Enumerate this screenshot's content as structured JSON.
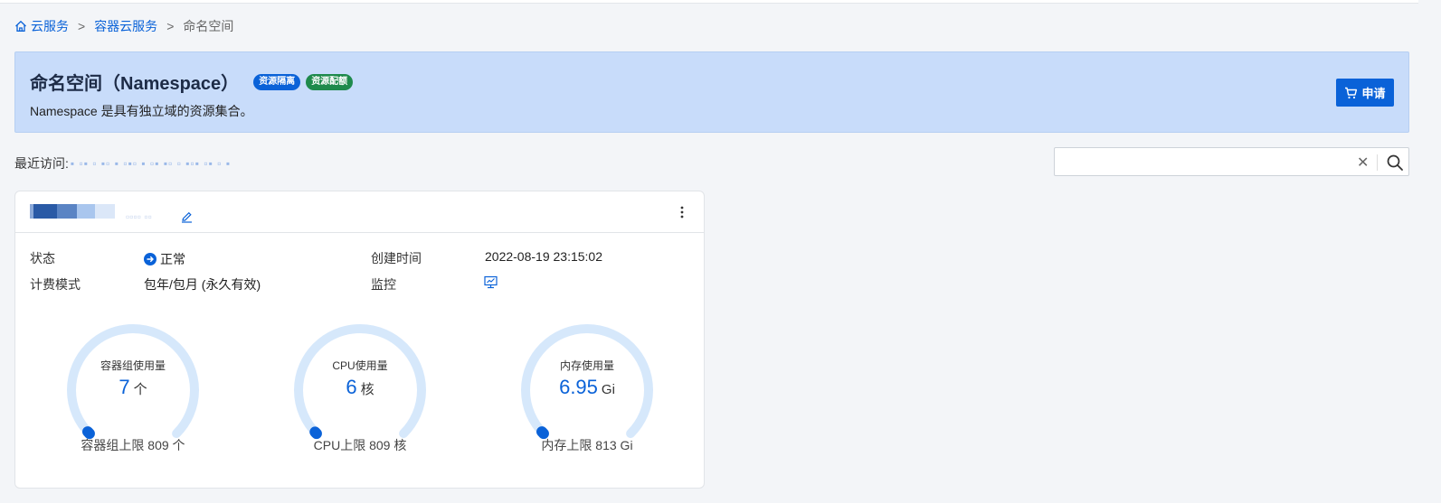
{
  "breadcrumb": {
    "home": "云服务",
    "sep1": ">",
    "level2": "容器云服务",
    "sep2": ">",
    "current": "命名空间"
  },
  "banner": {
    "title": "命名空间（Namespace）",
    "badge_isolation": "资源隔离",
    "badge_quota": "资源配额",
    "description": "Namespace 是具有独立域的资源集合。",
    "apply_label": "申请"
  },
  "recent": {
    "label": "最近访问:"
  },
  "search": {
    "value": ""
  },
  "card": {
    "status_label": "状态",
    "status_value": "正常",
    "created_label": "创建时间",
    "created_value": "2022-08-19 23:15:02",
    "billing_label": "计费模式",
    "billing_value": "包年/包月 (永久有效)",
    "monitor_label": "监控",
    "gauges": [
      {
        "title": "容器组使用量",
        "value": "7",
        "unit": "个",
        "limit_text": "容器组上限 809 个",
        "used": 7,
        "limit": 809
      },
      {
        "title": "CPU使用量",
        "value": "6",
        "unit": "核",
        "limit_text": "CPU上限 809 核",
        "used": 6,
        "limit": 809
      },
      {
        "title": "内存使用量",
        "value": "6.95",
        "unit": "Gi",
        "limit_text": "内存上限 813 Gi",
        "used": 6.95,
        "limit": 813
      }
    ]
  },
  "colors": {
    "accent": "#0a62d8",
    "banner_bg": "#c8dcfa",
    "gauge_track": "#d6e8fb",
    "badge_green": "#1f8a4c"
  }
}
